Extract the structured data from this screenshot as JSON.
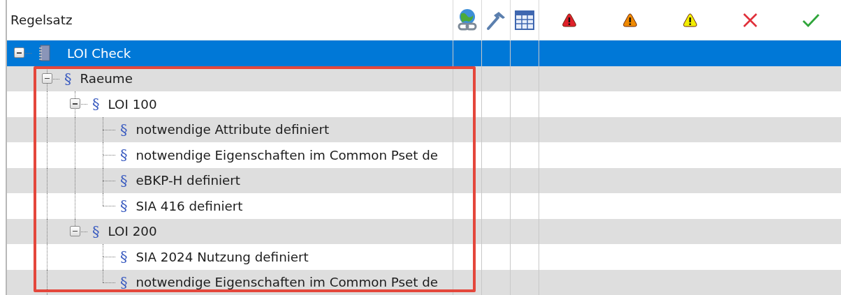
{
  "columns": [
    {
      "kind": "name",
      "label": "Regelsatz"
    },
    {
      "kind": "link"
    },
    {
      "kind": "tool"
    },
    {
      "kind": "table"
    },
    {
      "kind": "warning",
      "color": "#e0202a"
    },
    {
      "kind": "warning",
      "color": "#f08a00"
    },
    {
      "kind": "warning",
      "color": "#f2ee00"
    },
    {
      "kind": "failed"
    },
    {
      "kind": "passed"
    }
  ],
  "tree": [
    {
      "kind": "ruleset",
      "label": "LOI Check",
      "selected": true,
      "expanded": true,
      "children": [
        {
          "kind": "rule",
          "symbol": "§",
          "label": "Raeume",
          "selected": false,
          "expanded": true,
          "continues": true,
          "children": [
            {
              "kind": "rule",
              "symbol": "§",
              "label": "LOI 100",
              "selected": false,
              "expanded": true,
              "children": [
                {
                  "kind": "rule",
                  "symbol": "§",
                  "label": "notwendige Attribute definiert",
                  "selected": false
                },
                {
                  "kind": "rule",
                  "symbol": "§",
                  "label": "notwendige Eigenschaften im Common Pset de",
                  "selected": false
                },
                {
                  "kind": "rule",
                  "symbol": "§",
                  "label": "eBKP-H definiert",
                  "selected": false
                },
                {
                  "kind": "rule",
                  "symbol": "§",
                  "label": "SIA 416 definiert",
                  "selected": false
                }
              ]
            },
            {
              "kind": "rule",
              "symbol": "§",
              "label": "LOI 200",
              "selected": false,
              "expanded": true,
              "children": [
                {
                  "kind": "rule",
                  "symbol": "§",
                  "label": "SIA 2024 Nutzung definiert",
                  "selected": false
                },
                {
                  "kind": "rule",
                  "symbol": "§",
                  "label": "notwendige Eigenschaften im Common Pset de",
                  "selected": false
                }
              ]
            }
          ]
        }
      ]
    }
  ]
}
